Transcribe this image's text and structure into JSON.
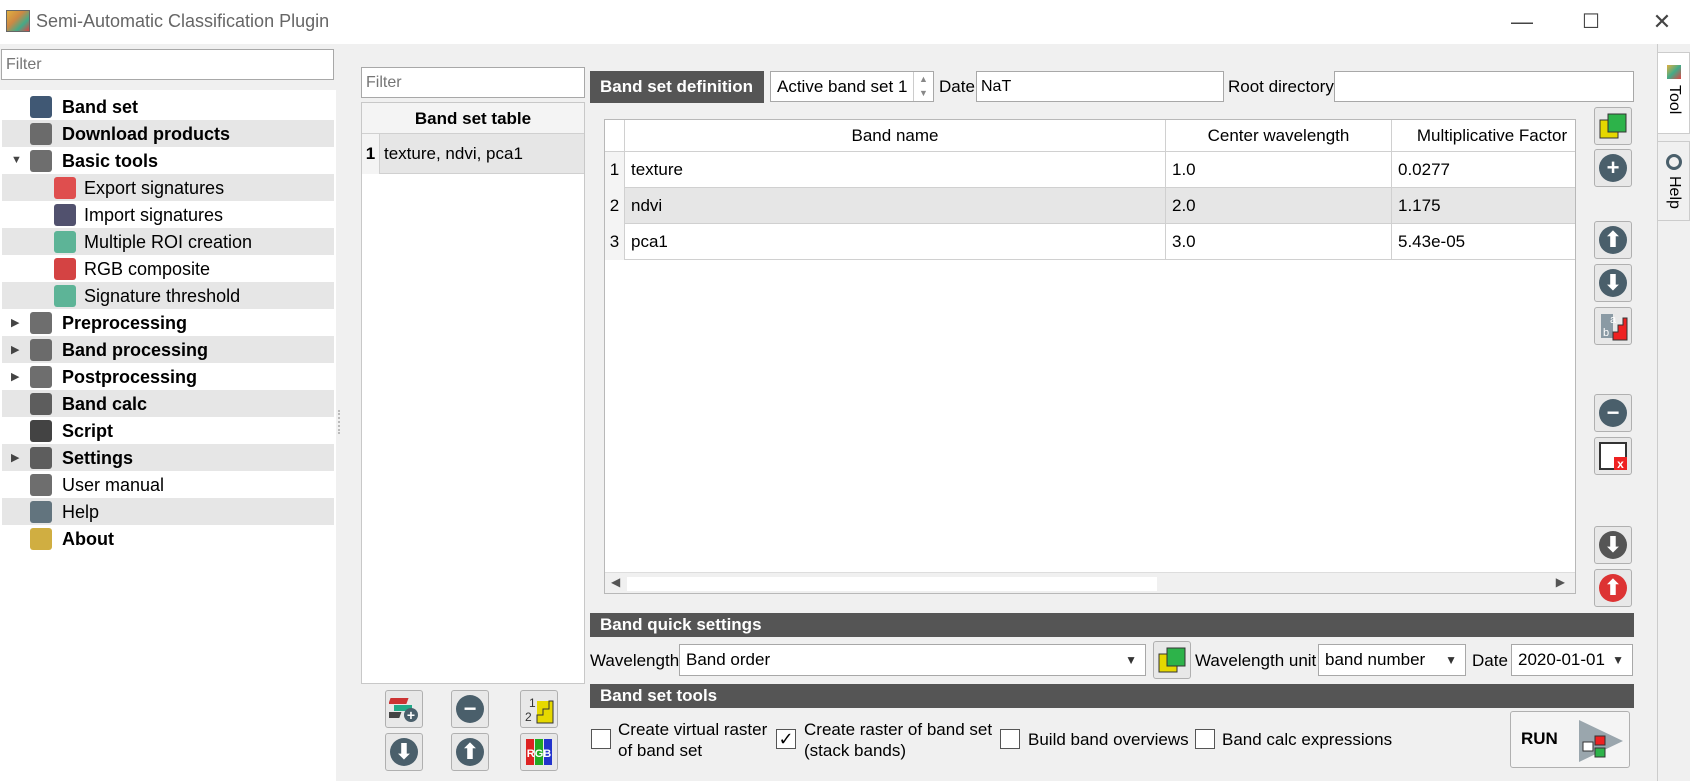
{
  "window": {
    "title": "Semi-Automatic Classification Plugin",
    "minimize": "—",
    "maximize": "☐",
    "close": "✕"
  },
  "left": {
    "filter_placeholder": "Filter",
    "tree": [
      {
        "label": "Band set",
        "bold": true,
        "icon": "band-set-icon"
      },
      {
        "label": "Download products",
        "bold": true,
        "icon": "download-icon"
      },
      {
        "label": "Basic tools",
        "bold": true,
        "icon": "basic-tools-icon"
      },
      {
        "label": "Export signatures",
        "bold": false,
        "icon": "export-signatures-icon"
      },
      {
        "label": "Import signatures",
        "bold": false,
        "icon": "import-signatures-icon"
      },
      {
        "label": "Multiple ROI creation",
        "bold": false,
        "icon": "multiple-roi-icon"
      },
      {
        "label": "RGB composite",
        "bold": false,
        "icon": "rgb-composite-icon"
      },
      {
        "label": "Signature threshold",
        "bold": false,
        "icon": "signature-threshold-icon"
      },
      {
        "label": "Preprocessing",
        "bold": true,
        "icon": "preprocessing-icon"
      },
      {
        "label": "Band processing",
        "bold": true,
        "icon": "band-processing-icon"
      },
      {
        "label": "Postprocessing",
        "bold": true,
        "icon": "postprocessing-icon"
      },
      {
        "label": "Band calc",
        "bold": true,
        "icon": "band-calc-icon"
      },
      {
        "label": "Script",
        "bold": true,
        "icon": "script-icon"
      },
      {
        "label": "Settings",
        "bold": true,
        "icon": "settings-icon"
      },
      {
        "label": "User manual",
        "bold": false,
        "icon": "user-manual-icon"
      },
      {
        "label": "Help",
        "bold": false,
        "icon": "help-icon"
      },
      {
        "label": "About",
        "bold": true,
        "icon": "about-icon"
      }
    ]
  },
  "bandset_table": {
    "filter_placeholder": "Filter",
    "header": "Band set table",
    "rows": [
      {
        "num": "1",
        "value": "texture, ndvi, pca1"
      }
    ]
  },
  "definition": {
    "header": "Band set definition",
    "active": "Active band set 1",
    "date_label": "Date",
    "date_value": "NaT",
    "root_label": "Root directory",
    "root_value": "",
    "columns": [
      "Band name",
      "Center wavelength",
      "Multiplicative Factor"
    ],
    "rows": [
      {
        "num": "1",
        "name": "texture",
        "wavelength": "1.0",
        "factor": "0.0277"
      },
      {
        "num": "2",
        "name": "ndvi",
        "wavelength": "2.0",
        "factor": "1.175"
      },
      {
        "num": "3",
        "name": "pca1",
        "wavelength": "3.0",
        "factor": "5.43e-05"
      }
    ]
  },
  "quick": {
    "header": "Band quick settings",
    "wavelength_label": "Wavelength",
    "wavelength_value": "Band order",
    "unit_label": "Wavelength unit",
    "unit_value": "band number",
    "date_label": "Date",
    "date_value": "2020-01-01"
  },
  "tools": {
    "header": "Band set tools",
    "virtual_raster": "Create virtual raster\nof band set",
    "virtual_line1": "Create virtual raster",
    "virtual_line2": "of band set",
    "stack_line1": "Create raster of band set",
    "stack_line2": "(stack bands)",
    "overviews": "Build band overviews",
    "calc_expr": "Band calc expressions",
    "run": "RUN",
    "checks": {
      "virtual": false,
      "stack": true,
      "overviews": false,
      "calc": false
    }
  },
  "sidetabs": {
    "tool": "Tool",
    "help": "Help"
  },
  "colors": {
    "header_bg": "#555555",
    "accent_green": "#2db34a"
  }
}
